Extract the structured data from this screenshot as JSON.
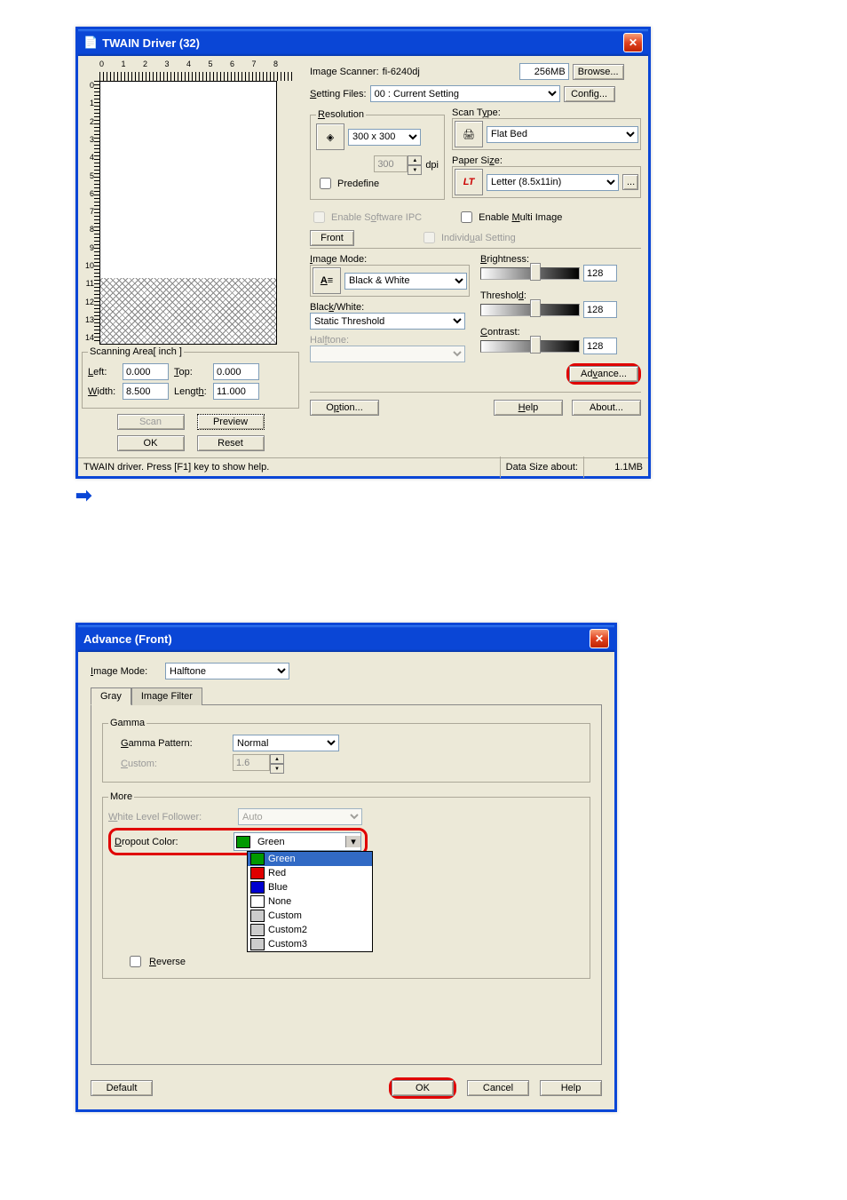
{
  "twin": {
    "title": "TWAIN Driver (32)",
    "ruler_h": [
      "0",
      "1",
      "2",
      "3",
      "4",
      "5",
      "6",
      "7",
      "8"
    ],
    "ruler_v": [
      "0",
      "1",
      "2",
      "3",
      "4",
      "5",
      "6",
      "7",
      "8",
      "9",
      "10",
      "11",
      "12",
      "13",
      "14"
    ],
    "scanning_area": {
      "legend": "Scanning Area[ inch ]",
      "left_label": "Left:",
      "left_val": "0.000",
      "top_label": "Top:",
      "top_val": "0.000",
      "width_label": "Width:",
      "width_val": "8.500",
      "length_label": "Length:",
      "length_val": "11.000"
    },
    "btn_scan": "Scan",
    "btn_preview": "Preview",
    "btn_ok": "OK",
    "btn_reset": "Reset",
    "scanner_label": "Image Scanner:",
    "scanner_val": "fi-6240dj",
    "mem_val": "256MB",
    "btn_browse": "Browse...",
    "setting_label": "Setting Files:",
    "setting_val": "00 : Current Setting",
    "btn_config": "Config...",
    "resolution": {
      "legend": "Resolution",
      "value": "300 x 300",
      "dpi_val": "300",
      "dpi_label": "dpi",
      "predefine": "Predefine"
    },
    "scantype": {
      "legend": "Scan Type:",
      "value": "Flat Bed"
    },
    "papersize": {
      "legend": "Paper Size:",
      "value": "Letter (8.5x11in)"
    },
    "enable_ipc": "Enable Software IPC",
    "enable_multi": "Enable Multi Image",
    "front_tab": "Front",
    "individual": "Individual Setting",
    "image_mode_label": "Image Mode:",
    "image_mode_val": "Black & White",
    "bw_label": "Black/White:",
    "bw_val": "Static Threshold",
    "halftone_label": "Halftone:",
    "brightness_label": "Brightness:",
    "threshold_label": "Threshold:",
    "contrast_label": "Contrast:",
    "slider_val": "128",
    "btn_advance": "Advance...",
    "btn_option": "Option...",
    "btn_help": "Help",
    "btn_about": "About...",
    "status_left": "TWAIN driver. Press [F1] key to show help.",
    "status_mid": "Data Size about:",
    "status_right": "1.1MB"
  },
  "adv": {
    "title": "Advance (Front)",
    "image_mode_label": "Image Mode:",
    "image_mode_val": "Halftone",
    "tab_gray": "Gray",
    "tab_filter": "Image Filter",
    "gamma_legend": "Gamma",
    "gamma_pattern_label": "Gamma Pattern:",
    "gamma_pattern_val": "Normal",
    "custom_label": "Custom:",
    "custom_val": "1.6",
    "more_legend": "More",
    "wlf_label": "White Level Follower:",
    "wlf_val": "Auto",
    "dropout_label": "Dropout Color:",
    "dropout_val": "Green",
    "dropout_options": [
      {
        "color": "#009900",
        "label": "Green",
        "selected": true
      },
      {
        "color": "#E00000",
        "label": "Red"
      },
      {
        "color": "#0000D0",
        "label": "Blue"
      },
      {
        "color": "#FFFFFF",
        "label": "None"
      },
      {
        "color": "#CCCCCC",
        "label": "Custom"
      },
      {
        "color": "#CCCCCC",
        "label": "Custom2"
      },
      {
        "color": "#CCCCCC",
        "label": "Custom3"
      }
    ],
    "reverse": "Reverse",
    "btn_default": "Default",
    "btn_ok": "OK",
    "btn_cancel": "Cancel",
    "btn_help": "Help"
  }
}
